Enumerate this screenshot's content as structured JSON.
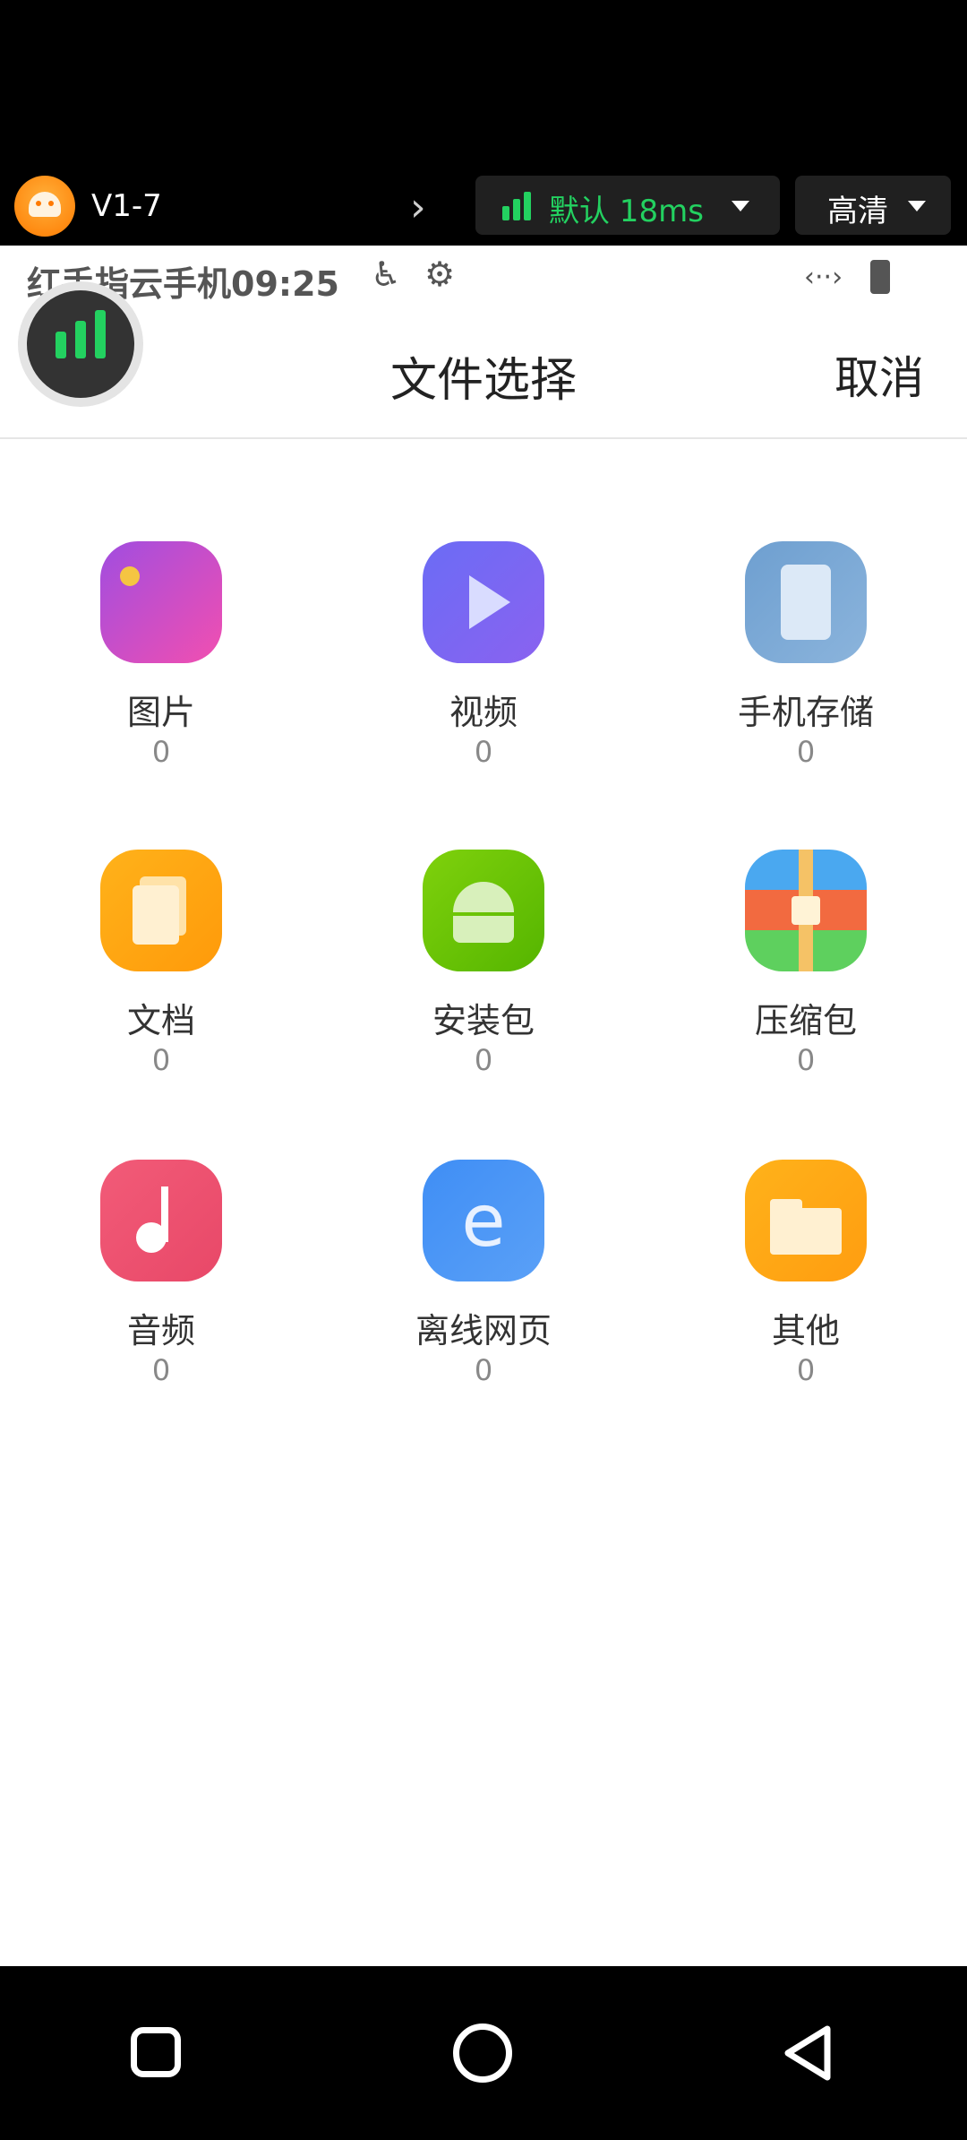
{
  "toolbar": {
    "device_name": "V1-7",
    "network_label": "默认 18ms",
    "network_color": "#23d160",
    "quality_label": "高清"
  },
  "statusbar": {
    "text": "红手指云手机09:25"
  },
  "header": {
    "title": "文件选择",
    "cancel_label": "取消"
  },
  "categories": [
    {
      "label": "图片",
      "count": "0",
      "icon": "image-icon"
    },
    {
      "label": "视频",
      "count": "0",
      "icon": "video-icon"
    },
    {
      "label": "手机存储",
      "count": "0",
      "icon": "phone-storage-icon"
    },
    {
      "label": "文档",
      "count": "0",
      "icon": "document-icon"
    },
    {
      "label": "安装包",
      "count": "0",
      "icon": "android-package-icon"
    },
    {
      "label": "压缩包",
      "count": "0",
      "icon": "archive-icon"
    },
    {
      "label": "音频",
      "count": "0",
      "icon": "music-icon"
    },
    {
      "label": "离线网页",
      "count": "0",
      "icon": "web-page-icon"
    },
    {
      "label": "其他",
      "count": "0",
      "icon": "folder-icon"
    }
  ]
}
